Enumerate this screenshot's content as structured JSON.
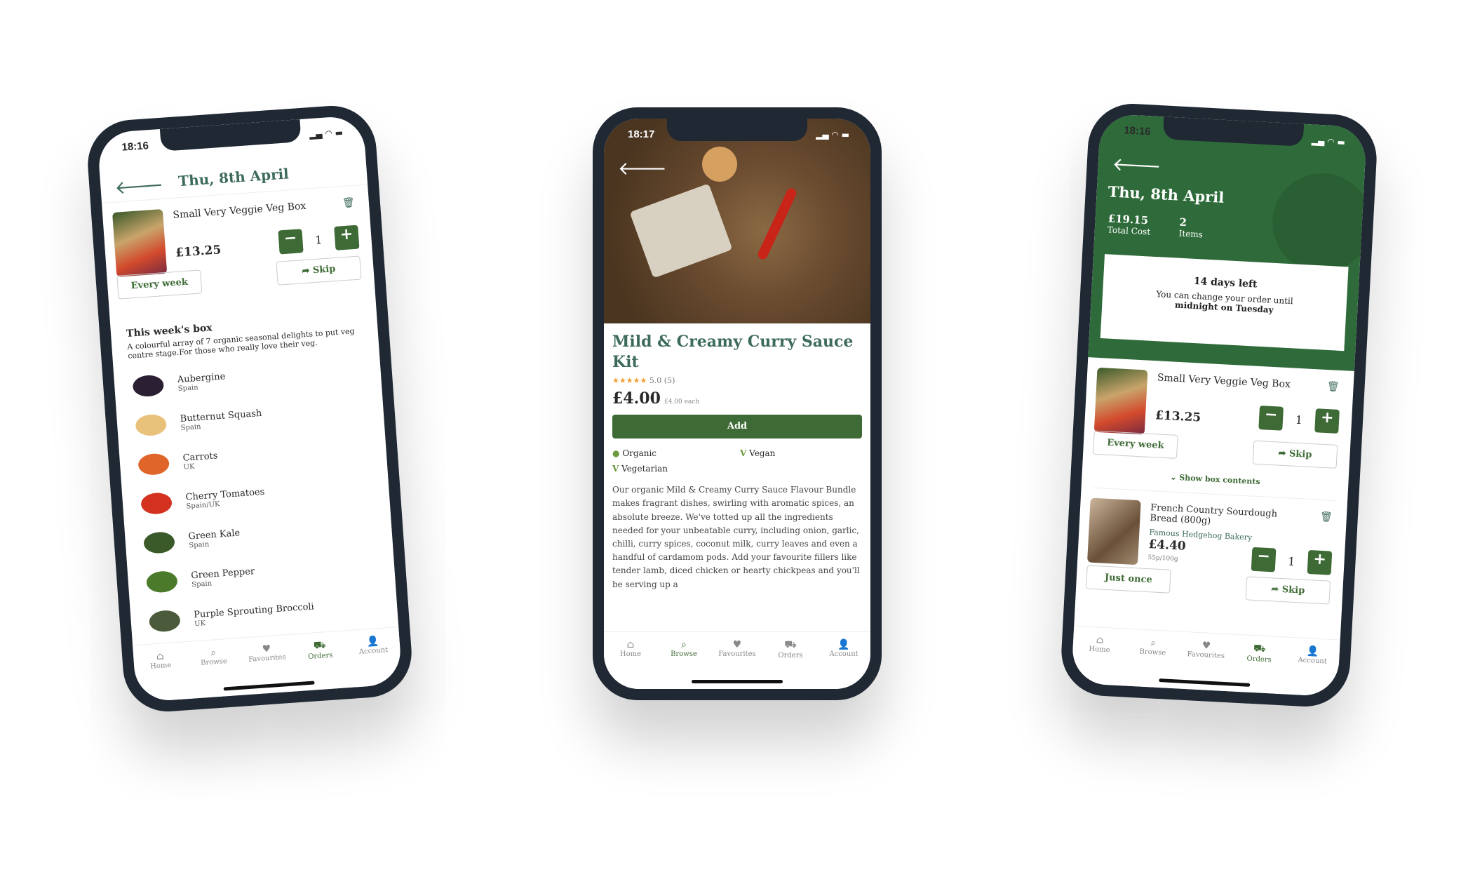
{
  "left": {
    "time": "18:16",
    "title": "Thu, 8th April",
    "item": {
      "name": "Small Very Veggie Veg Box",
      "price": "£13.25",
      "qty": "1",
      "frequency": "Every week",
      "skip": "Skip"
    },
    "box_title": "This week's box",
    "box_desc": "A colourful array of 7 organic seasonal delights to put veg centre stage.For those who really love their veg.",
    "veg": [
      {
        "name": "Aubergine",
        "origin": "Spain",
        "color": "#2a1f33"
      },
      {
        "name": "Butternut Squash",
        "origin": "Spain",
        "color": "#e8c27a"
      },
      {
        "name": "Carrots",
        "origin": "UK",
        "color": "#e0652a"
      },
      {
        "name": "Cherry Tomatoes",
        "origin": "Spain/UK",
        "color": "#d2321f"
      },
      {
        "name": "Green Kale",
        "origin": "Spain",
        "color": "#3a5a2a"
      },
      {
        "name": "Green Pepper",
        "origin": "Spain",
        "color": "#4a7a2a"
      },
      {
        "name": "Purple Sprouting Broccoli",
        "origin": "UK",
        "color": "#4a5a3a"
      }
    ]
  },
  "middle": {
    "time": "18:17",
    "product": "Mild & Creamy Curry Sauce Kit",
    "rating": "5.0 (5)",
    "stars": 5,
    "price": "£4.00",
    "unit_price": "£4.00 each",
    "add": "Add",
    "tags": [
      "Organic",
      "Vegan",
      "Vegetarian"
    ],
    "description": "Our organic Mild & Creamy Curry Sauce Flavour Bundle makes fragrant dishes, swirling with aromatic spices, an absolute breeze. We've totted up all the ingredients needed for your unbeatable curry, including onion, garlic, chilli, curry spices, coconut milk, curry leaves and even a handful of cardamom pods. Add your favourite fillers like tender lamb, diced chicken or hearty chickpeas and you'll be serving up a"
  },
  "right": {
    "time": "18:16",
    "title": "Thu, 8th April",
    "total": "£19.15",
    "total_label": "Total Cost",
    "items": "2",
    "items_label": "Items",
    "days_left": "14 days left",
    "change_text": "You can change your order until",
    "deadline": "midnight on Tuesday",
    "item1": {
      "name": "Small Very Veggie Veg Box",
      "price": "£13.25",
      "qty": "1",
      "frequency": "Every week",
      "skip": "Skip"
    },
    "show_contents": "Show box contents",
    "item2": {
      "name": "French Country Sourdough Bread (800g)",
      "supplier": "Famous Hedgehog Bakery",
      "price": "£4.40",
      "unit": "55p/100g",
      "qty": "1",
      "frequency": "Just once",
      "skip": "Skip"
    }
  },
  "nav": [
    "Home",
    "Browse",
    "Favourites",
    "Orders",
    "Account"
  ],
  "colors": {
    "brand_green": "#3e6b35",
    "title_green": "#3d6b5a",
    "header_green": "#2f6b3a",
    "star": "#f0a030"
  }
}
